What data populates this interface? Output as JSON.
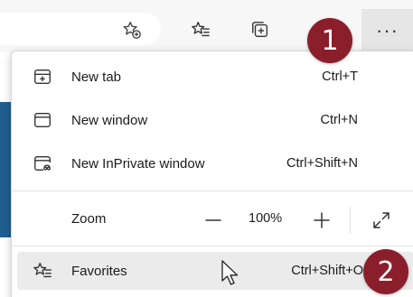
{
  "menu": {
    "items": [
      {
        "label": "New tab",
        "shortcut": "Ctrl+T",
        "icon": "new-tab-icon"
      },
      {
        "label": "New window",
        "shortcut": "Ctrl+N",
        "icon": "new-window-icon"
      },
      {
        "label": "New InPrivate window",
        "shortcut": "Ctrl+Shift+N",
        "icon": "inprivate-icon"
      }
    ],
    "zoom": {
      "label": "Zoom",
      "value": "100%",
      "decrease_icon": "minus-icon",
      "increase_icon": "plus-icon",
      "fullscreen_icon": "fullscreen-icon"
    },
    "favorites": {
      "label": "Favorites",
      "shortcut": "Ctrl+Shift+O",
      "icon": "favorites-list-icon"
    }
  },
  "toolbar": {
    "more_label": "···",
    "icons": [
      "add-favorite-icon",
      "favorites-icon",
      "collections-icon"
    ]
  },
  "badges": {
    "step1": "1",
    "step2": "2"
  },
  "colors": {
    "badge": "#8b1e2b",
    "hover": "#ebebeb"
  }
}
